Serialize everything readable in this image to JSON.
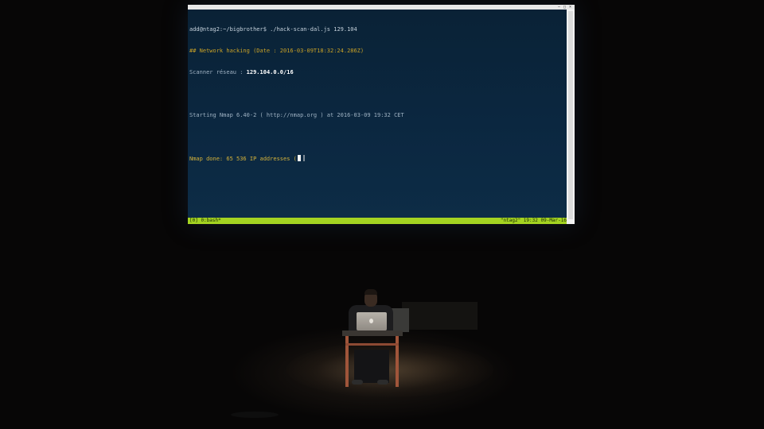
{
  "window_controls": [
    "–",
    "□",
    "×"
  ],
  "terminal": {
    "prompt": "add@ntag2:~/bigbrother$",
    "command": " ./hack-scan-dal.js 129.104",
    "title_comment": "## Network hacking (Date : 2016-03-09T18:32:24.286Z)",
    "scan_label": "Scanner réseau : ",
    "scan_value": "129.104.0.0/16",
    "nmap_start": "Starting Nmap 6.40-2 ( http://nmap.org ) at 2016-03-09 19:32 CET",
    "nmap_done": "Nmap done: 65 536 IP addresses ("
  },
  "status_bar": {
    "left": "[0] 0:bash*",
    "right": "\"ntag2\" 19:32 09-Mar-16",
    "color": "#a4d321"
  },
  "colors": {
    "terminal_bg": "#0b2740",
    "comment": "#c9a227"
  },
  "scene": {
    "laptop_logo": "apple-logo-icon"
  }
}
